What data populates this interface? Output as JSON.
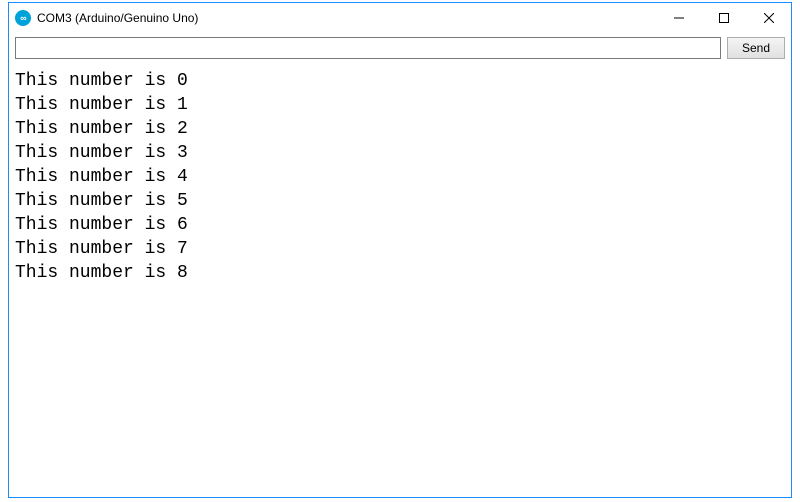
{
  "window": {
    "title": "COM3 (Arduino/Genuino Uno)"
  },
  "input": {
    "send_label": "Send",
    "value": "",
    "placeholder": ""
  },
  "output": {
    "lines": [
      "This number is 0",
      "This number is 1",
      "This number is 2",
      "This number is 3",
      "This number is 4",
      "This number is 5",
      "This number is 6",
      "This number is 7",
      "This number is 8"
    ]
  }
}
